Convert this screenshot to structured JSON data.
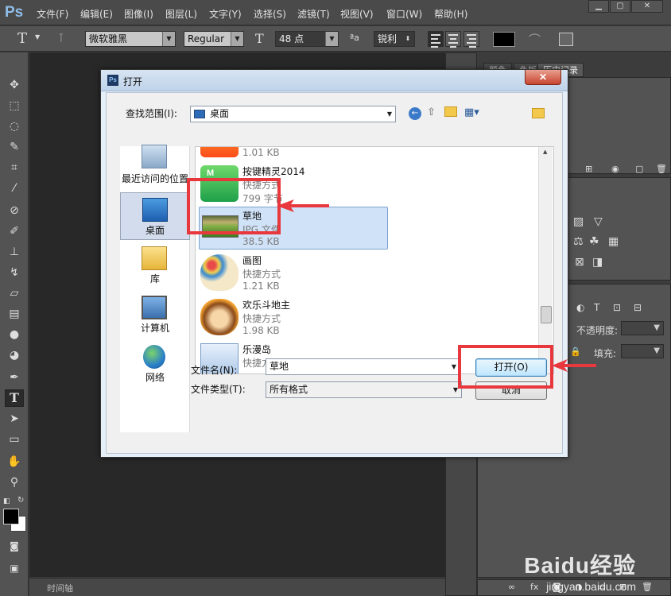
{
  "app": {
    "logo": "Ps"
  },
  "menu": [
    "文件(F)",
    "编辑(E)",
    "图像(I)",
    "图层(L)",
    "文字(Y)",
    "选择(S)",
    "滤镜(T)",
    "视图(V)",
    "窗口(W)",
    "帮助(H)"
  ],
  "window_controls": {
    "minimize": "▁",
    "restore": "▢",
    "close": "✕"
  },
  "options": {
    "tool_glyph": "T",
    "font_family": "微软雅黑",
    "font_style": "Regular",
    "font_size": "48 点",
    "aa_label": "ªa",
    "antialias": "锐利",
    "text_color": "#000000"
  },
  "right_panel": {
    "tabs": [
      "颜色",
      "色板",
      "历史记录"
    ],
    "opacity_label": "不透明度:",
    "fill_label": "填充:"
  },
  "timeline": {
    "label": "时间轴"
  },
  "dialog": {
    "title": "打开",
    "close": "✕",
    "lookin_label": "查找范围(I):",
    "lookin_value": "桌面",
    "places": [
      {
        "label": "最近访问的位置"
      },
      {
        "label": "桌面"
      },
      {
        "label": "库"
      },
      {
        "label": "计算机"
      },
      {
        "label": "网络"
      }
    ],
    "files": [
      {
        "name": "",
        "type": "",
        "size": "1.01 KB"
      },
      {
        "name": "按键精灵2014",
        "type": "快捷方式",
        "size": "799 字节"
      },
      {
        "name": "草地",
        "type": "JPG 文件",
        "size": "38.5 KB"
      },
      {
        "name": "画图",
        "type": "快捷方式",
        "size": "1.21 KB"
      },
      {
        "name": "欢乐斗地主",
        "type": "快捷方式",
        "size": "1.98 KB"
      },
      {
        "name": "乐漫岛",
        "type": "快捷方式",
        "size": ""
      }
    ],
    "filename_label": "文件名(N):",
    "filename_value": "草地",
    "filetype_label": "文件类型(T):",
    "filetype_value": "所有格式",
    "open_button": "打开(O)",
    "cancel_button": "取消"
  },
  "watermark": {
    "main": "Baidu经验",
    "sub": "jingyan.baidu.com"
  },
  "colors": {
    "highlight": "#e8383d",
    "selection": "#cfe2f7"
  }
}
